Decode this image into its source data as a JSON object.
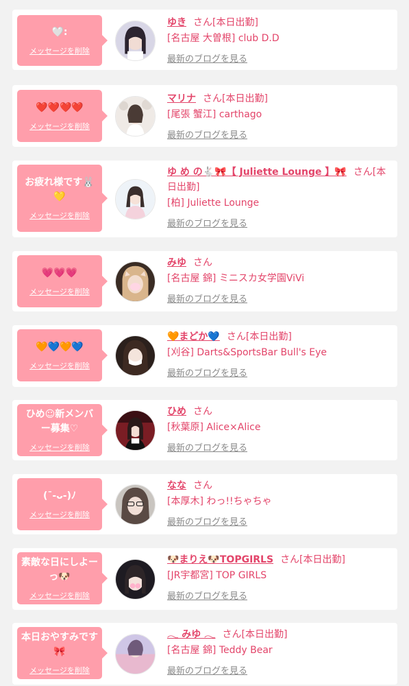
{
  "delete_label": "メッセージを削除",
  "blog_label": "最新のブログを見る",
  "items": [
    {
      "message": "🤍:",
      "name": "ゆき",
      "suffix": "さん[本日出勤]",
      "shop": "[名古屋 大曽根] club D.D"
    },
    {
      "message": "❤️❤️❤️❤️",
      "name": "マリナ",
      "suffix": "さん[本日出勤]",
      "shop": "[尾張 蟹江] carthago"
    },
    {
      "message": "お疲れ様です🐰💛",
      "name": "ゆ め の🐇🎀【 Juliette Lounge 】🎀",
      "suffix": "さん[本日出勤]",
      "shop": "[柏] Juliette Lounge"
    },
    {
      "message": "💗💗💗",
      "name": "みゆ",
      "suffix": "さん",
      "shop": "[名古屋 錦] ミニスカ女学園ViVi"
    },
    {
      "message": "🧡💙🧡💙",
      "name": "🧡まどか💙",
      "suffix": "さん[本日出勤]",
      "shop": "[刈谷] Darts&SportsBar Bull's Eye"
    },
    {
      "message": "ひめ☺︎新メンバー募集♡",
      "name": "ひめ",
      "suffix": "さん",
      "shop": "[秋葉原] Alice×Alice"
    },
    {
      "message": "(¯-ᴗ-)ﾉ",
      "name": "なな",
      "suffix": "さん",
      "shop": "[本厚木] わっ!!ちゃちゃ"
    },
    {
      "message": "素敵な日にしよーっ🐶",
      "name": "🐶まりえ🐶TOPGIRLS",
      "suffix": "さん[本日出勤]",
      "shop": "[JR宇都宮] TOP GIRLS"
    },
    {
      "message": "本日おやすみです🎀",
      "name": "𓂃 みゆ 𓂃",
      "suffix": "さん[本日出勤]",
      "shop": "[名古屋 錦] Teddy Bear"
    }
  ],
  "colors": {
    "bubble": "#ff9eab",
    "accent": "#e3456a",
    "link_gray": "#8a8a8a",
    "background": "#f2f2f2"
  }
}
